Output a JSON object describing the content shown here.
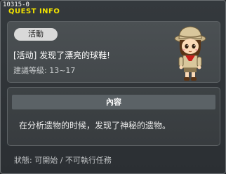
{
  "window": {
    "id_label": "10315-0",
    "title": "QUEST INFO"
  },
  "quest": {
    "category_badge": "活動",
    "title": "[活动] 发现了漂亮的球鞋!",
    "recommended_level": "建議等級: 13~17",
    "npc_icon": "explorer-girl-npc-icon"
  },
  "content": {
    "header": "內容",
    "description": "在分析遗物的时候，发现了神秘的遗物。"
  },
  "status": {
    "text": "狀態: 可開始 / 不可執行任務"
  },
  "colors": {
    "title_yellow": "#f1e200",
    "window_bg": "#34393d",
    "panel_bg": "#4b5053",
    "badge_bg": "#d9d9d9"
  }
}
